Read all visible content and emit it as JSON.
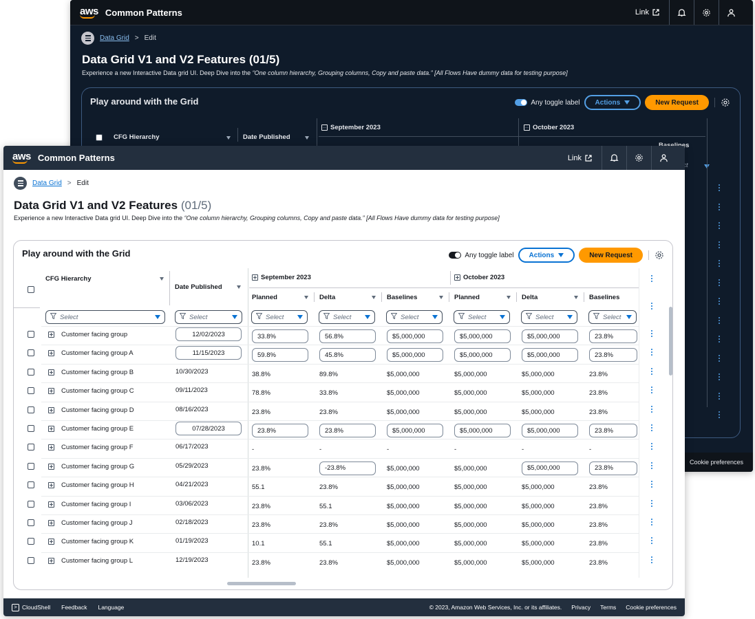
{
  "app": {
    "logo_text": "aws",
    "name": "Common Patterns",
    "link_label": "Link"
  },
  "breadcrumb": {
    "parent": "Data Grid",
    "separator": ">",
    "current": "Edit"
  },
  "page": {
    "title": "Data Grid V1 and V2 Features",
    "count": "(01/5)",
    "description_prefix": "Experience a new Interactive Data grid UI. Deep Dive into the",
    "description_quote": "“One column hierarchy, Grouping columns, Copy and paste data.”",
    "description_suffix": "[All Flows Have dummy data for testing purpose]"
  },
  "card": {
    "title": "Play around with the Grid",
    "toggle_label": "Any toggle label",
    "actions_label": "Actions",
    "primary_label": "New Request"
  },
  "grid": {
    "col_hierarchy": "CFG Hierarchy",
    "col_date": "Date Published",
    "groups": [
      "September 2023",
      "October 2023"
    ],
    "subcols": [
      "Planned",
      "Delta",
      "Baselines",
      "Planned",
      "Delta",
      "Baselines"
    ],
    "filter_placeholder": "Select",
    "rows": [
      {
        "name": "Customer facing group",
        "date": "12/02/2023",
        "date_edit": true,
        "vals": [
          "33.8%",
          "56.8%",
          "$5,000,000",
          "$5,000,000",
          "$5,000,000",
          "23.8%"
        ],
        "edit": [
          true,
          true,
          true,
          true,
          true,
          true
        ]
      },
      {
        "name": "Customer facing group A",
        "date": "11/15/2023",
        "date_edit": true,
        "vals": [
          "59.8%",
          "45.8%",
          "$5,000,000",
          "$5,000,000",
          "$5,000,000",
          "23.8%"
        ],
        "edit": [
          true,
          true,
          true,
          true,
          true,
          true
        ]
      },
      {
        "name": "Customer facing group B",
        "date": "10/30/2023",
        "date_edit": false,
        "vals": [
          "38.8%",
          "89.8%",
          "$5,000,000",
          "$5,000,000",
          "$5,000,000",
          "23.8%"
        ],
        "edit": [
          false,
          false,
          false,
          false,
          false,
          false
        ]
      },
      {
        "name": "Customer facing group C",
        "date": "09/11/2023",
        "date_edit": false,
        "vals": [
          "78.8%",
          "33.8%",
          "$5,000,000",
          "$5,000,000",
          "$5,000,000",
          "23.8%"
        ],
        "edit": [
          false,
          false,
          false,
          false,
          false,
          false
        ]
      },
      {
        "name": "Customer facing group D",
        "date": "08/16/2023",
        "date_edit": false,
        "vals": [
          "23.8%",
          "23.8%",
          "$5,000,000",
          "$5,000,000",
          "$5,000,000",
          "23.8%"
        ],
        "edit": [
          false,
          false,
          false,
          false,
          false,
          false
        ]
      },
      {
        "name": "Customer facing group E",
        "date": "07/28/2023",
        "date_edit": true,
        "vals": [
          "23.8%",
          "23.8%",
          "$5,000,000",
          "$5,000,000",
          "$5,000,000",
          "23.8%"
        ],
        "edit": [
          true,
          true,
          true,
          true,
          true,
          true
        ]
      },
      {
        "name": "Customer facing group F",
        "date": "06/17/2023",
        "date_edit": false,
        "vals": [
          "-",
          "-",
          "-",
          "-",
          "-",
          "-"
        ],
        "edit": [
          false,
          false,
          false,
          false,
          false,
          false
        ]
      },
      {
        "name": "Customer facing group G",
        "date": "05/29/2023",
        "date_edit": false,
        "vals": [
          "23.8%",
          "-23.8%",
          "$5,000,000",
          "$5,000,000",
          "$5,000,000",
          "23.8%"
        ],
        "edit": [
          false,
          true,
          false,
          false,
          true,
          true
        ]
      },
      {
        "name": "Customer facing group H",
        "date": "04/21/2023",
        "date_edit": false,
        "vals": [
          "55.1",
          "23.8%",
          "$5,000,000",
          "$5,000,000",
          "$5,000,000",
          "23.8%"
        ],
        "edit": [
          false,
          false,
          false,
          false,
          false,
          false
        ]
      },
      {
        "name": "Customer facing group I",
        "date": "03/06/2023",
        "date_edit": false,
        "vals": [
          "23.8%",
          "55.1",
          "$5,000,000",
          "$5,000,000",
          "$5,000,000",
          "23.8%"
        ],
        "edit": [
          false,
          false,
          false,
          false,
          false,
          false
        ]
      },
      {
        "name": "Customer facing group J",
        "date": "02/18/2023",
        "date_edit": false,
        "vals": [
          "23.8%",
          "23.8%",
          "$5,000,000",
          "$5,000,000",
          "$5,000,000",
          "23.8%"
        ],
        "edit": [
          false,
          false,
          false,
          false,
          false,
          false
        ]
      },
      {
        "name": "Customer facing group K",
        "date": "01/19/2023",
        "date_edit": false,
        "vals": [
          "10.1",
          "55.1",
          "$5,000,000",
          "$5,000,000",
          "$5,000,000",
          "23.8%"
        ],
        "edit": [
          false,
          false,
          false,
          false,
          false,
          false
        ]
      },
      {
        "name": "Customer facing group L",
        "date": "12/19/2023",
        "date_edit": false,
        "vals": [
          "23.8%",
          "23.8%",
          "$5,000,000",
          "$5,000,000",
          "$5,000,000",
          "23.8%"
        ],
        "edit": [
          false,
          false,
          false,
          false,
          false,
          false
        ]
      }
    ]
  },
  "dark_grid_fragment": {
    "subcols_visible": [
      "Planned",
      "Delta",
      "Baselines",
      "Planned",
      "Delta",
      "Baselines"
    ],
    "select_fragment": "ect"
  },
  "footer": {
    "cloudshell": "CloudShell",
    "feedback": "Feedback",
    "language": "Language",
    "copyright": "© 2023, Amazon Web Services, Inc. or its affiliates.",
    "privacy": "Privacy",
    "terms": "Terms",
    "cookies": "Cookie preferences"
  },
  "colors": {
    "topbar_light": "#232f3e",
    "topbar_dark": "#0f141a",
    "accent_blue": "#0972d3",
    "primary_orange": "#ff9900",
    "dark_bg": "#0f1b2a"
  },
  "icons": [
    "external-link-icon",
    "bell-icon",
    "gear-icon",
    "user-icon",
    "menu-icon",
    "filter-icon",
    "expand-icon",
    "more-vertical-icon",
    "toggle-icon"
  ]
}
